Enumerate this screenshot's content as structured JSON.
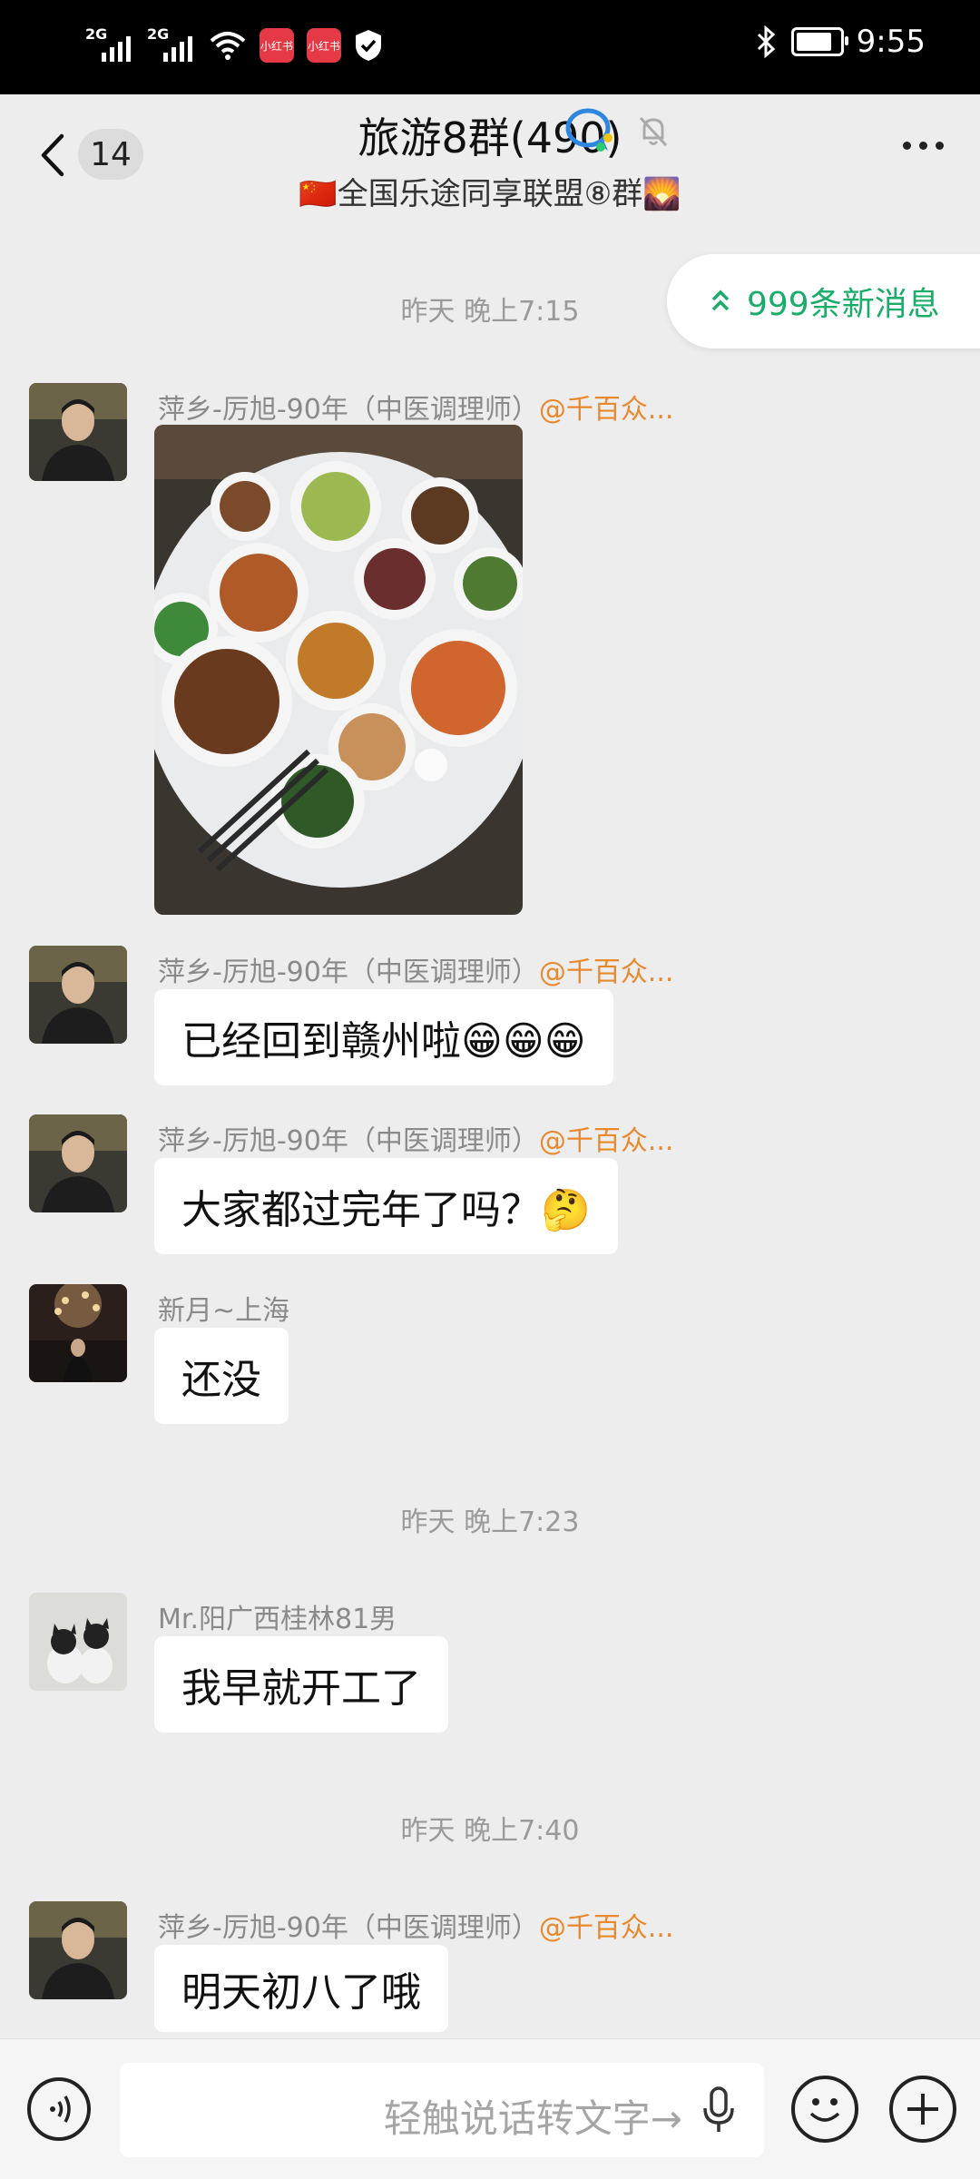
{
  "status": {
    "net1": "2G",
    "net2": "2G",
    "app1": "小红书",
    "app2": "小红书",
    "time": "9:55"
  },
  "header": {
    "back_count": "14",
    "title": "旅游8群(490)",
    "subtitle": "🇨🇳全国乐途同享联盟⑧群🌄"
  },
  "new_messages": {
    "label": "999条新消息"
  },
  "timestamps": [
    "昨天 晚上7:15",
    "昨天 晚上7:23",
    "昨天 晚上7:40"
  ],
  "messages": [
    {
      "sender": "萍乡-厉旭-90年（中医调理师）",
      "at": "@千百众...",
      "text": ""
    },
    {
      "sender": "萍乡-厉旭-90年（中医调理师）",
      "at": "@千百众...",
      "text": "已经回到赣州啦😁😁😁"
    },
    {
      "sender": "萍乡-厉旭-90年（中医调理师）",
      "at": "@千百众...",
      "text": "大家都过完年了吗？🤔"
    },
    {
      "sender": "新月~上海",
      "at": "",
      "text": "还没"
    },
    {
      "sender": "Mr.阳广西桂林81男",
      "at": "",
      "text": "我早就开工了"
    },
    {
      "sender": "萍乡-厉旭-90年（中医调理师）",
      "at": "@千百众...",
      "text": "明天初八了哦"
    }
  ],
  "input": {
    "placeholder": "轻触说话转文字→"
  },
  "colors": {
    "accent_green": "#1aad6a",
    "mention_orange": "#e8892e"
  }
}
